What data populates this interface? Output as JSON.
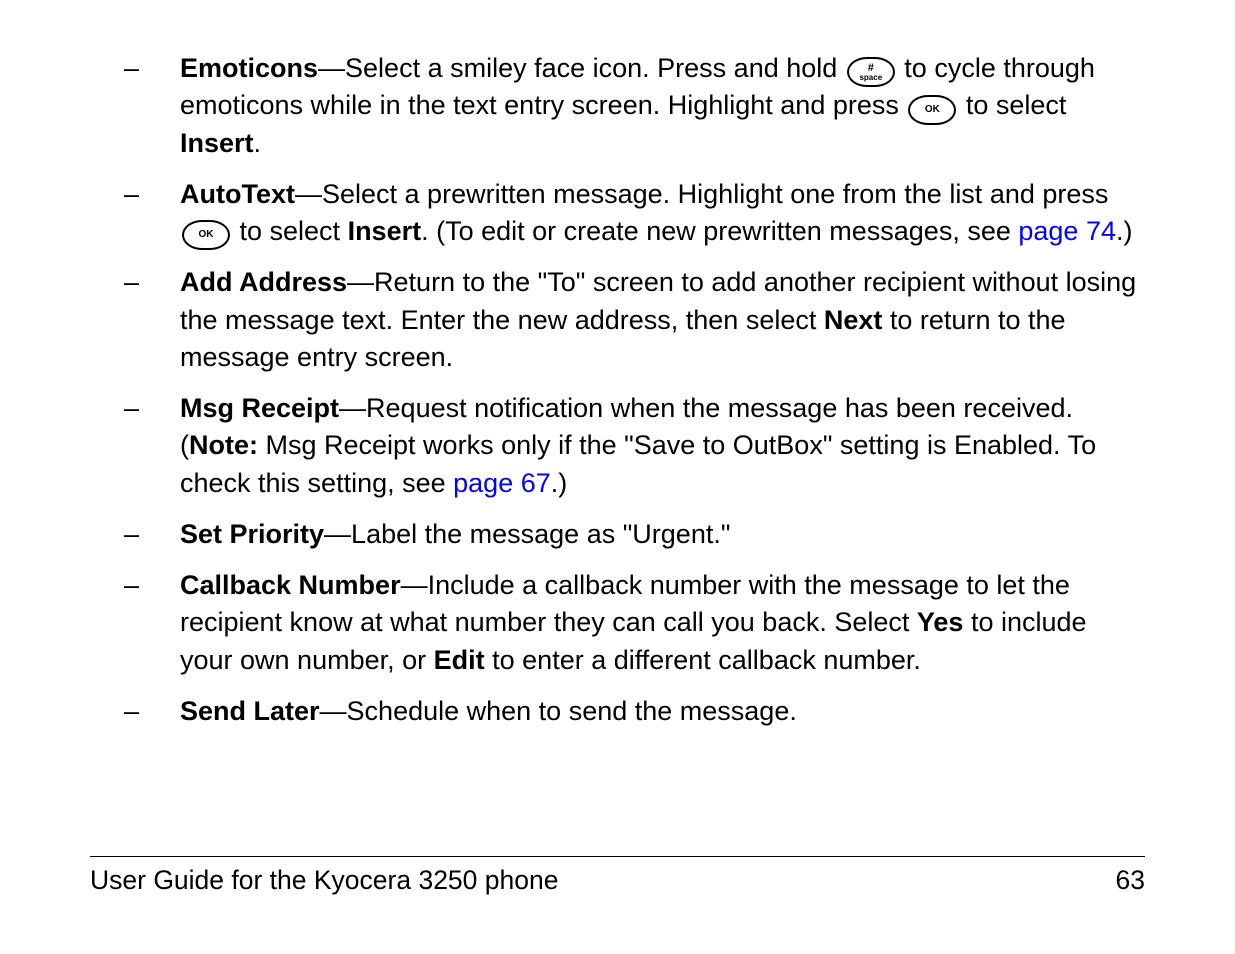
{
  "items": [
    {
      "title": "Emoticons",
      "body_a": "—Select a smiley face icon. Press and hold ",
      "body_b": " to cycle through emoticons while in the text entry screen. Highlight and press ",
      "body_c": " to select ",
      "insert": "Insert",
      "body_d": "."
    },
    {
      "title": "AutoText",
      "body_a": "—Select a prewritten message. Highlight one from the list and press ",
      "body_b": " to select ",
      "insert": "Insert",
      "body_c": ". (To edit or create new prewritten messages, see ",
      "link": "page 74",
      "body_d": ".)"
    },
    {
      "title": "Add Address",
      "body_a": "—Return to the \"To\" screen to add another recipient without losing the message text. Enter the new address, then select ",
      "next": "Next",
      "body_b": " to return to the message entry screen."
    },
    {
      "title": "Msg Receipt",
      "body_a": "—Request notification when the message has been received. (",
      "note": "Note:",
      "body_b": " Msg Receipt works only if the \"Save to OutBox\" setting is Enabled. To check this setting, see ",
      "link": "page 67",
      "body_c": ".)"
    },
    {
      "title": "Set Priority",
      "body_a": "—Label the message as \"Urgent.\""
    },
    {
      "title": "Callback Number",
      "body_a": "—Include a callback number with the message to let the recipient know at what number they can call you back. Select ",
      "yes": "Yes",
      "body_b": " to include your own number, or ",
      "edit": "Edit",
      "body_c": " to enter a different callback number."
    },
    {
      "title": "Send Later",
      "body_a": "—Schedule when to send the message."
    }
  ],
  "keys": {
    "ok": "OK",
    "hash": "#",
    "space": "space"
  },
  "footer": {
    "left": "User Guide for the Kyocera 3250 phone",
    "right": "63"
  }
}
